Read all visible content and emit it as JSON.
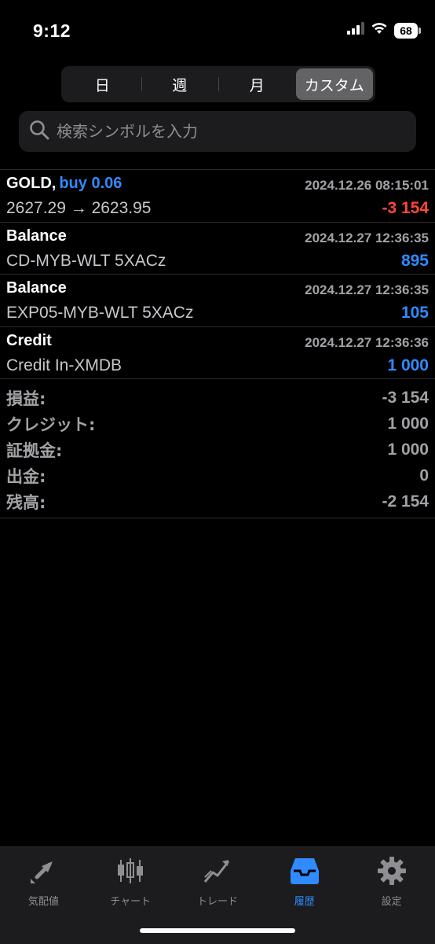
{
  "status": {
    "time": "9:12",
    "battery": "68"
  },
  "periods": [
    "日",
    "週",
    "月",
    "カスタム"
  ],
  "active_period": 3,
  "search": {
    "placeholder": "検索シンボルを入力"
  },
  "trade": {
    "symbol": "GOLD,",
    "side": "buy 0.06",
    "time": "2024.12.26 08:15:01",
    "prices": "2627.29 → 2623.95",
    "profit": "-3 154"
  },
  "ops": [
    {
      "type": "Balance",
      "time": "2024.12.27 12:36:35",
      "comment": "CD-MYB-WLT 5XACz",
      "amount": "895"
    },
    {
      "type": "Balance",
      "time": "2024.12.27 12:36:35",
      "comment": "EXP05-MYB-WLT 5XACz",
      "amount": "105"
    },
    {
      "type": "Credit",
      "time": "2024.12.27 12:36:36",
      "comment": "Credit In-XMDB",
      "amount": "1 000"
    }
  ],
  "summary": [
    {
      "label": "損益:",
      "value": "-3 154"
    },
    {
      "label": "クレジット:",
      "value": "1 000"
    },
    {
      "label": "証拠金:",
      "value": "1 000"
    },
    {
      "label": "出金:",
      "value": "0"
    },
    {
      "label": "残高:",
      "value": "-2 154"
    }
  ],
  "tabs": [
    {
      "label": "気配値",
      "icon": "quotes-arrows-icon"
    },
    {
      "label": "チャート",
      "icon": "candlestick-chart-icon"
    },
    {
      "label": "トレード",
      "icon": "trade-chart-icon"
    },
    {
      "label": "履歴",
      "icon": "history-inbox-icon"
    },
    {
      "label": "設定",
      "icon": "gear-icon"
    }
  ],
  "active_tab": 3,
  "colors": {
    "accent": "#2f8bff",
    "loss": "#ff453a",
    "background": "#000000"
  }
}
